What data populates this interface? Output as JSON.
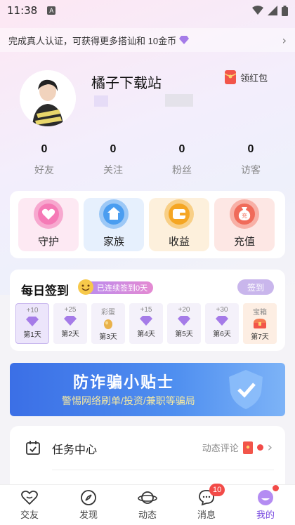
{
  "status_bar": {
    "time": "11:38",
    "a_icon": "A"
  },
  "banner": {
    "text": "完成真人认证，可获得更多搭讪和 10金币",
    "gem_icon": "diamond-icon",
    "arrow": "›"
  },
  "profile": {
    "username": "橘子下载站",
    "red_packet_label": "领红包",
    "stats": [
      {
        "value": "0",
        "label": "好友"
      },
      {
        "value": "0",
        "label": "关注"
      },
      {
        "value": "0",
        "label": "粉丝"
      },
      {
        "value": "0",
        "label": "访客"
      }
    ]
  },
  "features": [
    {
      "label": "守护",
      "icon": "heart-icon",
      "color": "#f57ab6"
    },
    {
      "label": "家族",
      "icon": "home-icon",
      "color": "#4a9df0"
    },
    {
      "label": "收益",
      "icon": "wallet-icon",
      "color": "#f5a623"
    },
    {
      "label": "充值",
      "icon": "money-bag-icon",
      "color": "#f06b5a"
    }
  ],
  "checkin": {
    "title": "每日签到",
    "streak": "已连续签到0天",
    "button": "签到",
    "days": [
      {
        "reward": "+10",
        "label": "第1天",
        "icon": "diamond"
      },
      {
        "reward": "+25",
        "label": "第2天",
        "icon": "diamond"
      },
      {
        "reward": "彩蛋",
        "label": "第3天",
        "icon": "egg"
      },
      {
        "reward": "+15",
        "label": "第4天",
        "icon": "diamond"
      },
      {
        "reward": "+20",
        "label": "第5天",
        "icon": "diamond"
      },
      {
        "reward": "+30",
        "label": "第6天",
        "icon": "diamond"
      },
      {
        "reward": "宝箱",
        "label": "第7天",
        "icon": "chest"
      }
    ]
  },
  "fraud_banner": {
    "title": "防诈骗小贴士",
    "subtitle": "警惕网络刷单/投资/兼职等骗局"
  },
  "task_center": {
    "label": "任务中心",
    "sub": "动态评论",
    "arrow": "›"
  },
  "bottom_nav": [
    {
      "label": "交友",
      "icon": "heart-outline-icon"
    },
    {
      "label": "发现",
      "icon": "compass-icon"
    },
    {
      "label": "动态",
      "icon": "planet-icon"
    },
    {
      "label": "消息",
      "icon": "chat-icon",
      "badge": "10"
    },
    {
      "label": "我的",
      "icon": "me-icon",
      "active": true
    }
  ],
  "colors": {
    "accent": "#7a4de0",
    "badge": "#f24b48"
  }
}
